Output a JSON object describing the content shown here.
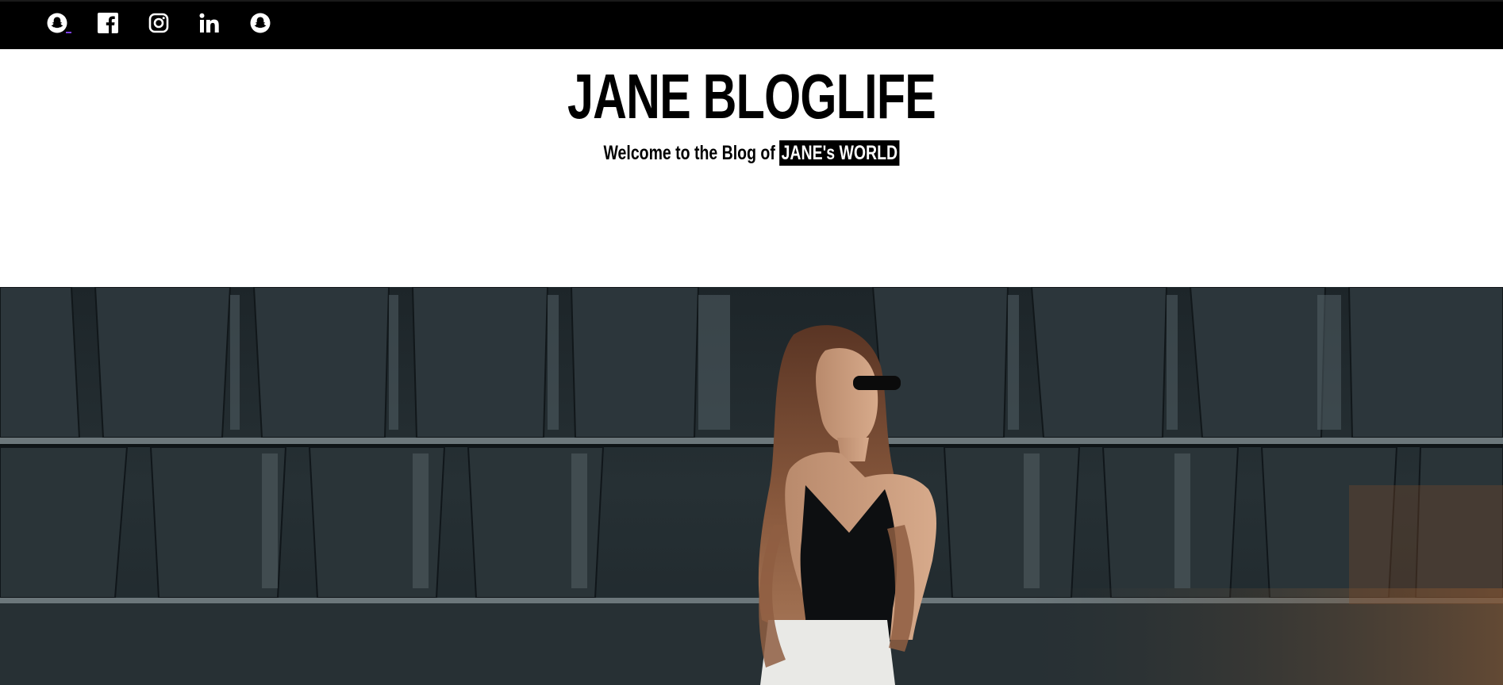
{
  "topbar": {
    "social_icons": [
      {
        "name": "snapchat-icon",
        "label": "Snapchat"
      },
      {
        "name": "facebook-icon",
        "label": "Facebook"
      },
      {
        "name": "instagram-icon",
        "label": "Instagram"
      },
      {
        "name": "linkedin-icon",
        "label": "LinkedIn"
      },
      {
        "name": "snapchat-icon",
        "label": "Snapchat"
      }
    ],
    "background": "#000000",
    "active_underline_color": "#7b3fe4"
  },
  "header": {
    "title": "JANE BLOGLIFE",
    "tagline_prefix": "Welcome to the Blog of ",
    "tagline_highlight": "JANE's WORLD"
  },
  "hero": {
    "subject": "woman with long brown hair and sunglasses in black top and white skirt, in front of dark rusty metal wall"
  }
}
